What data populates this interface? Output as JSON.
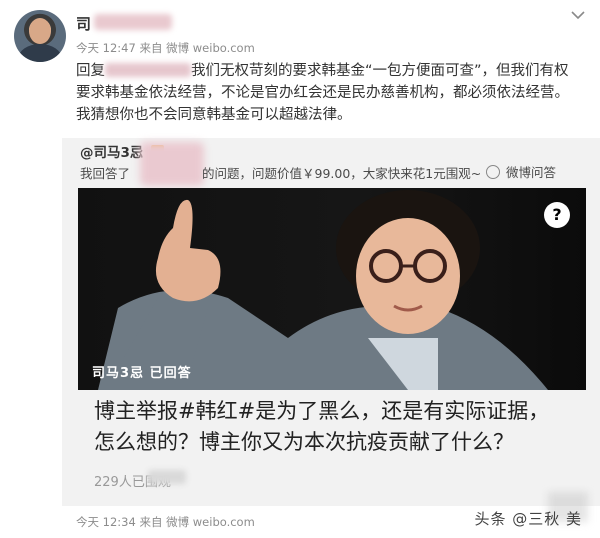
{
  "post": {
    "author": "司",
    "meta_time": "今天 12:47",
    "meta_source_label": "来自",
    "meta_source": "微博 weibo.com",
    "reply_prefix": "回复",
    "reply_body": "我们无权苛刻的要求韩基金“一包方便面可查”，但我们有权要求韩基金依法经营，不论是官办红会还是民办慈善机构，都必须依法经营。我猜想你也不会同意韩基金可以超越法律。"
  },
  "repost": {
    "author": "@司马3忌",
    "answer_prefix": "我回答了",
    "answer_suffix": "的问题，问题价值￥99.00，大家快来花1元围观~",
    "weibo_qa": "微博问答",
    "photo_caption": "司马3忌 已回答",
    "question": "博主举报#韩红#是为了黑么，还是有实际证据，怎么想的？博主你又为本次抗疫贡献了什么？",
    "views_count": "229",
    "views_label": "人已围观"
  },
  "footer": {
    "meta_time": "今天 12:34",
    "meta_source_label": "来自",
    "meta_source": "微博 weibo.com",
    "watermark": "头条 @三秋 美"
  },
  "icons": {
    "chevron": "chevron-down-icon",
    "question": "question-mark-icon",
    "play": "play-icon"
  }
}
